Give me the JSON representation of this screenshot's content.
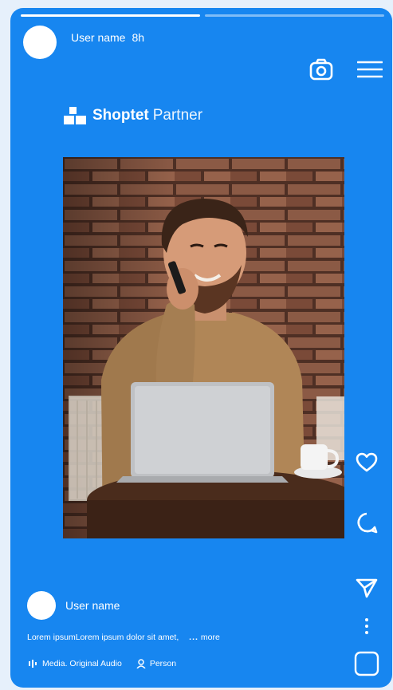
{
  "story": {
    "progress": [
      1.0,
      0.0
    ]
  },
  "header": {
    "username": "User name",
    "time": "8h"
  },
  "brand": {
    "name_bold": "Shoptet",
    "name_light": "Partner"
  },
  "post": {
    "author": "User name",
    "caption": "Lorem ipsumLorem ipsum dolor sit amet,",
    "more_dots": "...",
    "more_label": "more",
    "audio": "Media. Original Audio",
    "person": "Person"
  },
  "colors": {
    "background": "#1786f0",
    "page": "#e6f0fb",
    "foreground": "#ffffff"
  },
  "icons": [
    "camera-icon",
    "menu-icon",
    "heart-icon",
    "comment-icon",
    "send-icon",
    "more-vertical-icon",
    "square-icon",
    "audio-icon",
    "person-icon",
    "shoptet-logo-icon"
  ]
}
